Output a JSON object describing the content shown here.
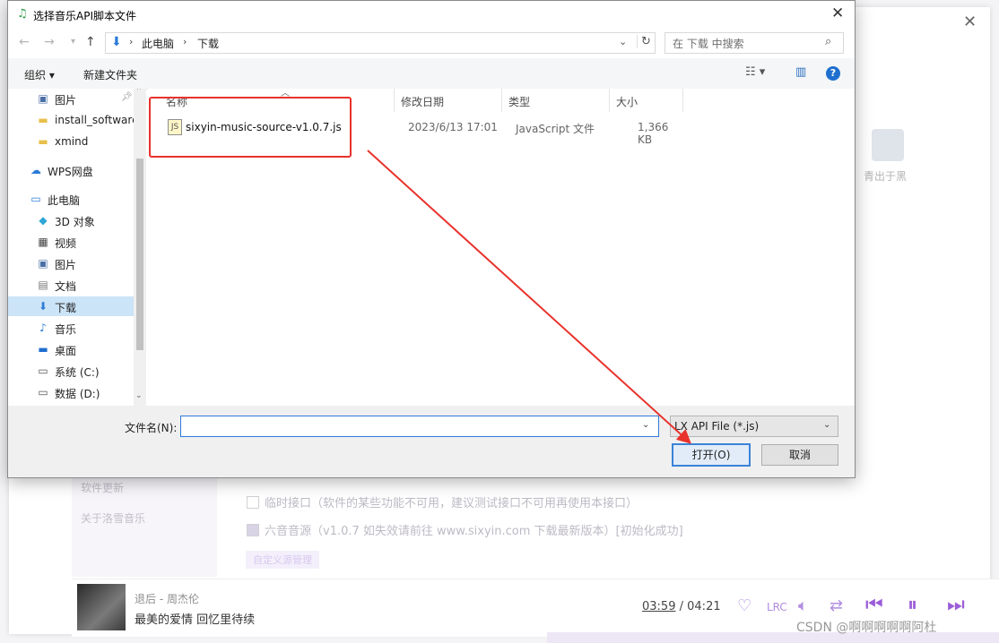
{
  "background_app": {
    "song_label": "青出于黑",
    "nav_items": [
      "软件更新",
      "关于洛雪音乐"
    ],
    "options": [
      {
        "label": "临时接口（软件的某些功能不可用，建议测试接口不可用再使用本接口）",
        "checked": false
      },
      {
        "label": "六音音源（v1.0.7 如失效请前往 www.sixyin.com 下载最新版本）[初始化成功]",
        "checked": true
      }
    ],
    "custom_source_btn": "自定义源管理",
    "player": {
      "song_title": "退后 - 周杰伦",
      "lyric": "最美的爱情 回忆里待续",
      "time_current": "03:59",
      "time_sep": "/",
      "time_total": "04:21",
      "lrc_label": "LRC"
    },
    "watermark": "CSDN @啊啊啊啊啊阿杜"
  },
  "dialog": {
    "title": "选择音乐API脚本文件",
    "close": "✕",
    "address": {
      "path": [
        "此电脑",
        "下载"
      ],
      "search_placeholder": "在 下载 中搜索"
    },
    "toolbar": {
      "organize": "组织 ▾",
      "new_folder": "新建文件夹",
      "help": "?"
    },
    "nav_pane": [
      {
        "label": "图片",
        "icon": "picture-icon",
        "level": 2,
        "pinned": true
      },
      {
        "label": "install_software",
        "icon": "folder-icon",
        "level": 2
      },
      {
        "label": "xmind",
        "icon": "folder-icon",
        "level": 2
      },
      {
        "label": "WPS网盘",
        "icon": "cloud-icon",
        "level": 1
      },
      {
        "label": "此电脑",
        "icon": "computer-icon",
        "level": 1
      },
      {
        "label": "3D 对象",
        "icon": "cube-icon",
        "level": 2
      },
      {
        "label": "视频",
        "icon": "video-icon",
        "level": 2
      },
      {
        "label": "图片",
        "icon": "picture-icon",
        "level": 2
      },
      {
        "label": "文档",
        "icon": "document-icon",
        "level": 2
      },
      {
        "label": "下载",
        "icon": "download-icon",
        "level": 2,
        "selected": true
      },
      {
        "label": "音乐",
        "icon": "music-icon",
        "level": 2
      },
      {
        "label": "桌面",
        "icon": "desktop-icon",
        "level": 2
      },
      {
        "label": "系统 (C:)",
        "icon": "drive-icon",
        "level": 2
      },
      {
        "label": "数据 (D:)",
        "icon": "drive-icon",
        "level": 2
      }
    ],
    "columns": [
      "名称",
      "修改日期",
      "类型",
      "大小"
    ],
    "files": [
      {
        "name": "sixyin-music-source-v1.0.7.js",
        "date": "2023/6/13 17:01",
        "type": "JavaScript 文件",
        "size": "1,366 KB"
      }
    ],
    "filename_label": "文件名(N):",
    "filename_value": "",
    "filetype": "LX API File (*.js)",
    "open_button": "打开(O)",
    "cancel_button": "取消"
  },
  "colors": {
    "highlight_red": "#e8322c",
    "accent_purple": "#9b5ed9",
    "selection_blue": "#cce4f7"
  }
}
